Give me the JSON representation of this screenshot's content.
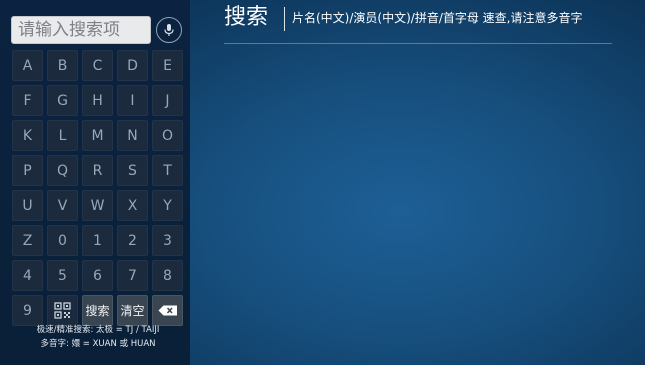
{
  "search": {
    "placeholder": "请输入搜索项",
    "voice_icon": "mic-icon"
  },
  "keyboard": {
    "rows": [
      [
        "A",
        "B",
        "C",
        "D",
        "E"
      ],
      [
        "F",
        "G",
        "H",
        "I",
        "J"
      ],
      [
        "K",
        "L",
        "M",
        "N",
        "O"
      ],
      [
        "P",
        "Q",
        "R",
        "S",
        "T"
      ],
      [
        "U",
        "V",
        "W",
        "X",
        "Y"
      ],
      [
        "Z",
        "0",
        "1",
        "2",
        "3"
      ],
      [
        "4",
        "5",
        "6",
        "7",
        "8"
      ]
    ],
    "last_row": {
      "nine": "9",
      "qr_icon": "qr-code-icon",
      "search_label": "搜索",
      "clear_label": "清空",
      "backspace_icon": "backspace-icon"
    }
  },
  "hint": {
    "line1": "极速/精准搜索: 太极 = TJ / TAIJI",
    "line2": "多音字: 嬛 = XUAN 或 HUAN"
  },
  "header": {
    "title": "搜索",
    "subtitle": "片名(中文)/演员(中文)/拼音/首字母 速查,请注意多音字"
  }
}
